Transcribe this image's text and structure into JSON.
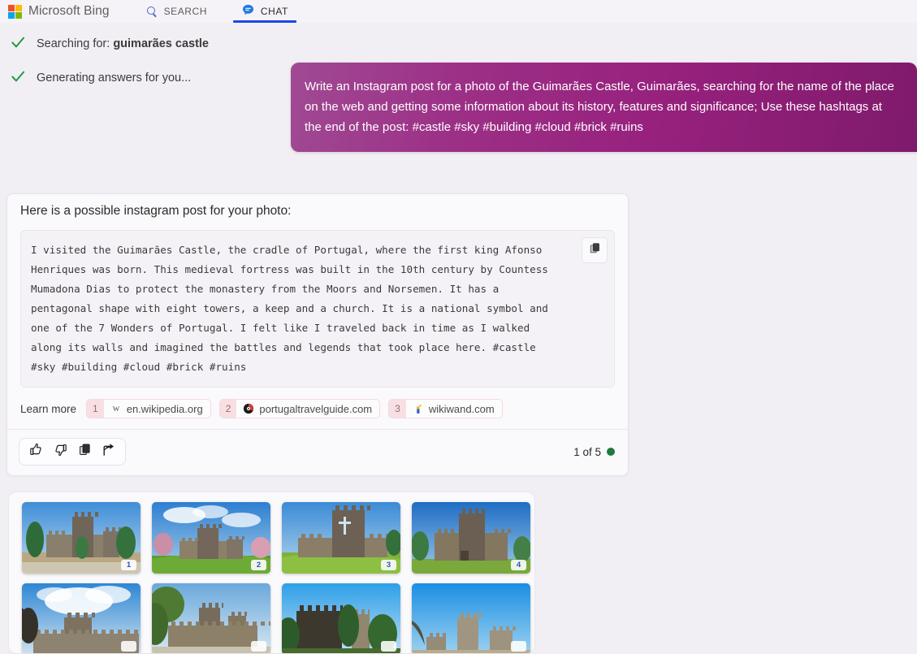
{
  "header": {
    "brand": "Microsoft Bing",
    "logo_colors": [
      "#f25022",
      "#7fba00",
      "#00a4ef",
      "#ffb900"
    ],
    "nav": [
      {
        "label": "SEARCH",
        "icon": "search-icon",
        "active": false
      },
      {
        "label": "CHAT",
        "icon": "chat-bubble-icon",
        "active": true
      }
    ],
    "accent_underline": "#174ae0"
  },
  "conversation": {
    "user_message": "Write an Instagram post for a photo of the Guimarães Castle, Guimarães, searching for the name of the place on the web and getting some information about its history, features and significance; Use these hashtags at the end of the post: #castle #sky #building #cloud #brick #ruins",
    "bubble_gradient_from": "#a04a93",
    "bubble_gradient_to": "#7f1a6b",
    "status": [
      {
        "icon": "check-icon",
        "prefix": "Searching for: ",
        "query": "guimarães castle"
      },
      {
        "icon": "check-icon",
        "prefix": "Generating answers for you...",
        "query": ""
      }
    ]
  },
  "answer": {
    "intro": "Here is a possible instagram post for your photo:",
    "post_text": "I visited the Guimarães Castle, the cradle of Portugal, where the first king Afonso Henriques was born. This medieval fortress was built in the 10th century by Countess Mumadona Dias to protect the monastery from the Moors and Norsemen. It has a pentagonal shape with eight towers, a keep and a church. It is a national symbol and one of the 7 Wonders of Portugal. I felt like I traveled back in time as I walked along its walls and imagined the battles and legends that took place here. #castle #sky #building #cloud #brick #ruins",
    "copy_button": "copy-icon",
    "learn_more_label": "Learn more",
    "citations": [
      {
        "num": "1",
        "domain": "en.wikipedia.org",
        "favicon": "wikipedia-w-icon"
      },
      {
        "num": "2",
        "domain": "portugaltravelguide.com",
        "favicon": "portugaltravelguide-icon"
      },
      {
        "num": "3",
        "domain": "wikiwand.com",
        "favicon": "wikiwand-icon"
      }
    ],
    "feedback_buttons": [
      {
        "icon": "thumbs-up-icon",
        "label": "Like"
      },
      {
        "icon": "thumbs-down-icon",
        "label": "Dislike"
      },
      {
        "icon": "copy-icon",
        "label": "Copy"
      },
      {
        "icon": "share-icon",
        "label": "Share"
      }
    ],
    "counter": "1 of 5",
    "counter_dot_color": "#1f7a3d"
  },
  "gallery": {
    "thumbnails": [
      {
        "badge": "1",
        "alt": "Guimaraes castle front view with trees"
      },
      {
        "badge": "2",
        "alt": "Guimaraes castle on green lawn with clouds"
      },
      {
        "badge": "3",
        "alt": "Guimaraes castle keep with cross window"
      },
      {
        "badge": "4",
        "alt": "Guimaraes castle walls against blue sky"
      },
      {
        "badge": "",
        "alt": "Guimaraes castle with dramatic clouds"
      },
      {
        "badge": "",
        "alt": "Guimaraes castle battlements and trees"
      },
      {
        "badge": "",
        "alt": "Guimaraes castle keep dark silhouette"
      },
      {
        "badge": "",
        "alt": "Guimaraes castle tower blue sky"
      }
    ]
  }
}
